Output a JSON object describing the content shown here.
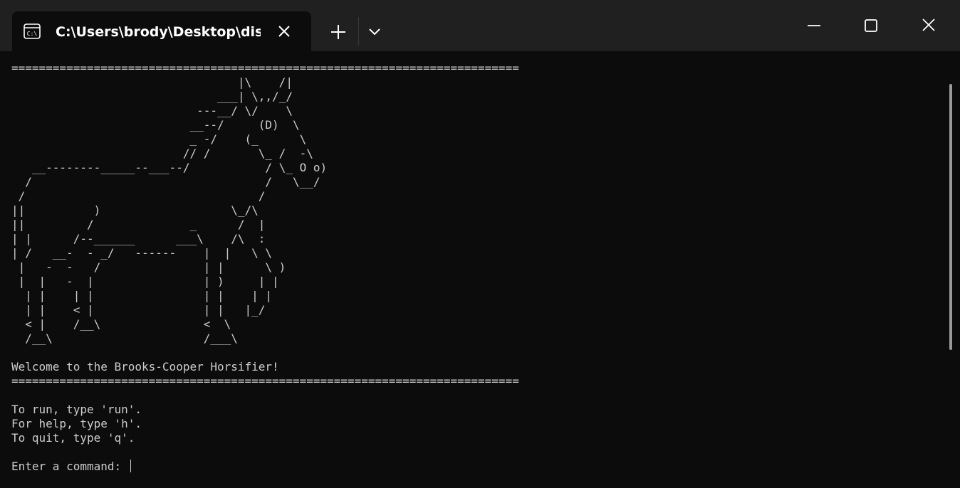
{
  "window": {
    "tab_title": "C:\\Users\\brody\\Desktop\\dist\\",
    "tab_icon": "terminal-icon",
    "colors": {
      "titlebar": "#202020",
      "console_bg": "#0c0c0c",
      "console_text": "#cccccc"
    }
  },
  "console": {
    "separator": "==========================================================================",
    "art": "                                 |\\    /|\n                              ___| \\,,/_/\n                           ---__/ \\/    \\\n                          __--/     (D)  \\\n                          _ -/    (_      \\\n                         // /       \\_ /  -\\\n   __--------_____--___--/           / \\_ O o)\n  /                                  /   \\__/\n /                                  /\n||          )                   \\_/\\\n||         /              _      /  |\n| |      /--______      ___\\    /\\  :\n| /   __-  - _/   ------    |  |   \\ \\\n |   -  -   /               | |      \\ )\n |  |   -  |                | )     | |\n  | |    | |                | |    | |\n  | |    < |                | |   |_/\n  < |    /__\\               <  \\\n  /__\\                      /___\\",
    "welcome": "Welcome to the Brooks-Cooper Horsifier!",
    "instructions": [
      "To run, type 'run'.",
      "For help, type 'h'.",
      "To quit, type 'q'."
    ],
    "prompt": "Enter a command: "
  }
}
